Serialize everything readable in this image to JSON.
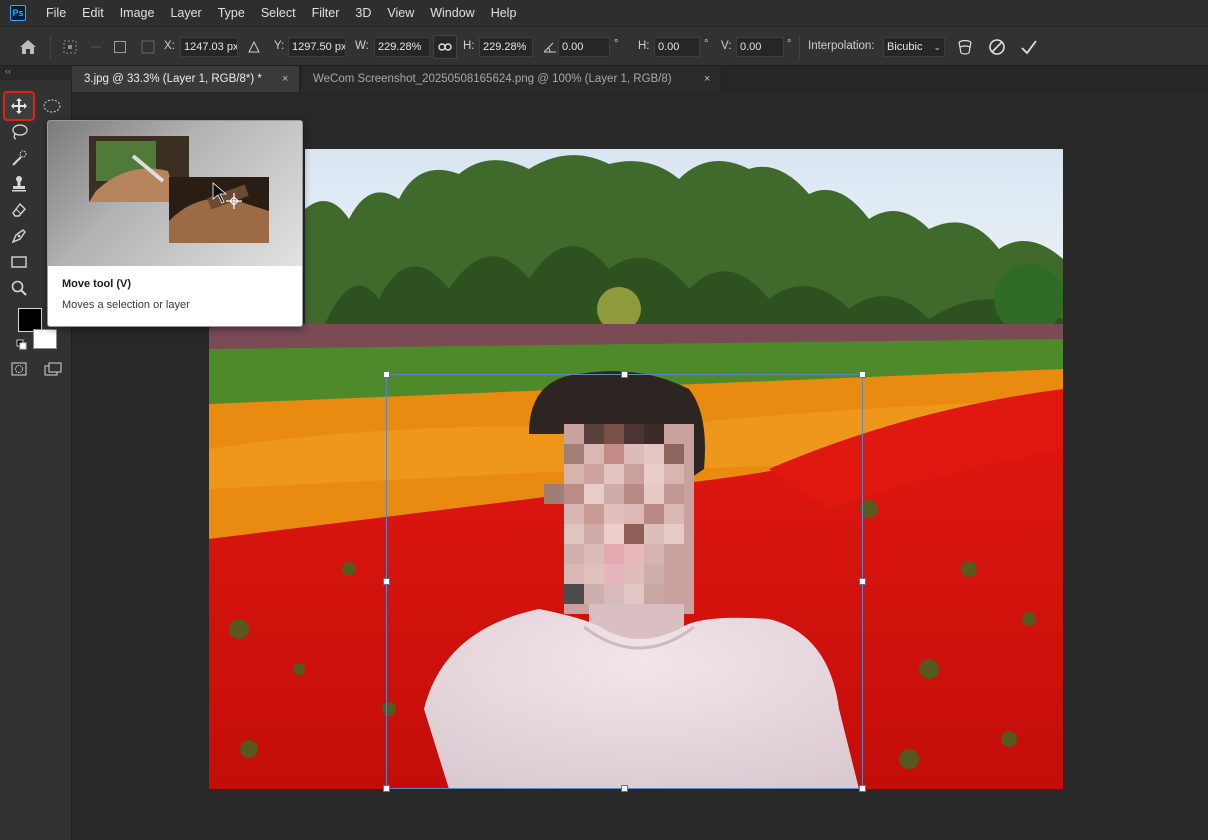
{
  "app": {
    "logo_text": "Ps"
  },
  "menu": [
    "File",
    "Edit",
    "Image",
    "Layer",
    "Type",
    "Select",
    "Filter",
    "3D",
    "View",
    "Window",
    "Help"
  ],
  "options": {
    "x_label": "X:",
    "x_value": "1247.03 px",
    "y_label": "Y:",
    "y_value": "1297.50 px",
    "w_label": "W:",
    "w_value": "229.28%",
    "h_label": "H:",
    "h_value": "229.28%",
    "angle_value": "0.00",
    "hskew_label": "H:",
    "hskew_value": "0.00",
    "vskew_label": "V:",
    "vskew_value": "0.00",
    "degree_symbol": "°",
    "interpolation_label": "Interpolation:",
    "interpolation_value": "Bicubic"
  },
  "tabs": [
    {
      "label": "3.jpg @ 33.3% (Layer 1, RGB/8*) *",
      "close": "×",
      "active": true
    },
    {
      "label": "WeCom Screenshot_20250508165624.png @ 100% (Layer 1, RGB/8)",
      "close": "×",
      "active": false
    }
  ],
  "toolbar": {
    "collapse_glyph": "‹‹"
  },
  "tooltip": {
    "title": "Move tool (V)",
    "description": "Moves a selection or layer"
  },
  "colors": {
    "foreground": "#000000",
    "background": "#ffffff",
    "selection_outline": "#e0201b",
    "transform_box": "#5b85c8"
  }
}
